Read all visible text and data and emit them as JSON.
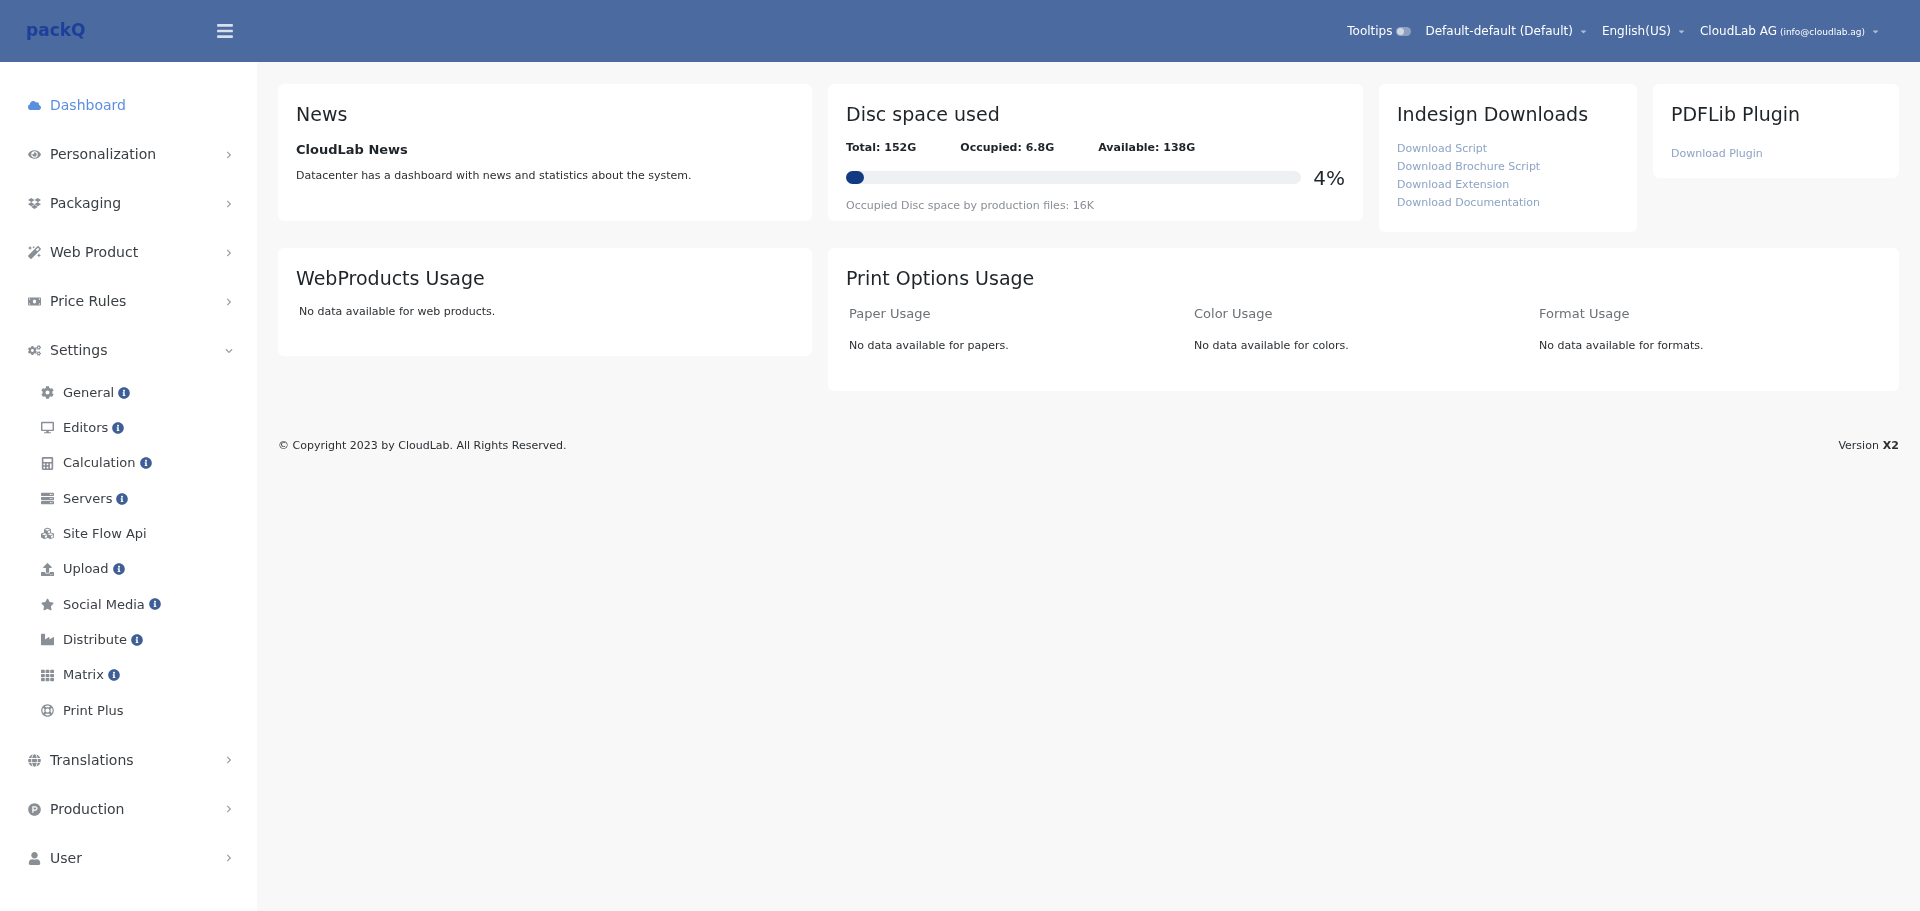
{
  "header": {
    "logo": "packQ",
    "tooltips": {
      "label": "Tooltips",
      "on": false
    },
    "menus": [
      {
        "label": "Default-default (Default)"
      },
      {
        "label": "English(US)"
      },
      {
        "label": "CloudLab AG",
        "note": "(info@cloudlab.ag)"
      }
    ]
  },
  "sidebar": {
    "items": [
      {
        "label": "Dashboard",
        "selected": true
      },
      {
        "label": "Personalization",
        "selected": false,
        "expanded": false
      },
      {
        "label": "Packaging",
        "selected": false,
        "expanded": false
      },
      {
        "label": "Web Product",
        "selected": false,
        "expanded": false
      },
      {
        "label": "Price Rules",
        "selected": false,
        "expanded": false
      },
      {
        "label": "Settings",
        "selected": false,
        "expanded": true,
        "children": [
          {
            "label": "General",
            "info": true
          },
          {
            "label": "Editors",
            "info": true
          },
          {
            "label": "Calculation",
            "info": true
          },
          {
            "label": "Servers",
            "info": true
          },
          {
            "label": "Site Flow Api",
            "info": false
          },
          {
            "label": "Upload",
            "info": true
          },
          {
            "label": "Social Media",
            "info": true
          },
          {
            "label": "Distribute",
            "info": true
          },
          {
            "label": "Matrix",
            "info": true
          },
          {
            "label": "Print Plus",
            "info": false
          }
        ]
      },
      {
        "label": "Translations",
        "selected": false,
        "expanded": false
      },
      {
        "label": "Production",
        "selected": false,
        "expanded": false
      },
      {
        "label": "User",
        "selected": false,
        "expanded": false
      }
    ]
  },
  "news": {
    "title": "News",
    "heading": "CloudLab News",
    "text": "Datacenter has a dashboard with news and statistics about the system."
  },
  "disc": {
    "title": "Disc space used",
    "stats": [
      "Total: 152G",
      "Occupied: 6.8G",
      "Available: 138G"
    ],
    "level": 0.04,
    "percent": "4%",
    "note": "Occupied Disc space by production files: 16K"
  },
  "indesign": {
    "title": "Indesign Downloads",
    "links": [
      "Download Script",
      "Download Brochure Script",
      "Download Extension",
      "Download Documentation"
    ]
  },
  "pdflib": {
    "title": "PDFLib Plugin",
    "links": [
      "Download Plugin"
    ]
  },
  "webproducts": {
    "title": "WebProducts Usage",
    "text": "No data available for web products."
  },
  "print_options": {
    "title": "Print Options Usage",
    "columns": [
      {
        "title": "Paper Usage",
        "text": "No data available for papers."
      },
      {
        "title": "Color Usage",
        "text": "No data available for colors."
      },
      {
        "title": "Format Usage",
        "text": "No data available for formats."
      }
    ]
  },
  "footer": {
    "copyright": "© Copyright 2023 by CloudLab. All Rights Reserved.",
    "version_label": "Version",
    "version": "X2"
  }
}
